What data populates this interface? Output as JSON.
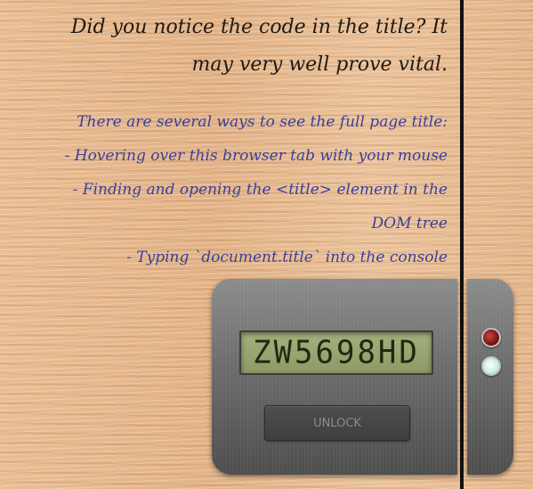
{
  "heading": {
    "line1": "Did you notice the code in the title? It",
    "line2": "may very well prove vital."
  },
  "hints": [
    "There are several ways to see the full page title:",
    "- Hovering over this browser tab with your mouse",
    "- Finding and opening the <title> element in the",
    "DOM tree",
    "- Typing `document.title` into the console"
  ],
  "lock": {
    "display": "ZW5698HD",
    "unlock_label": "UNLOCK",
    "led_top": "red",
    "led_bottom": "white"
  },
  "colors": {
    "heading_text": "#1f1a16",
    "hint_text": "#3a3f9a",
    "lcd_bg": "#98a46e",
    "panel_metal": "#6c6c6c",
    "led_red": "#c44",
    "led_white": "#ffffff"
  }
}
